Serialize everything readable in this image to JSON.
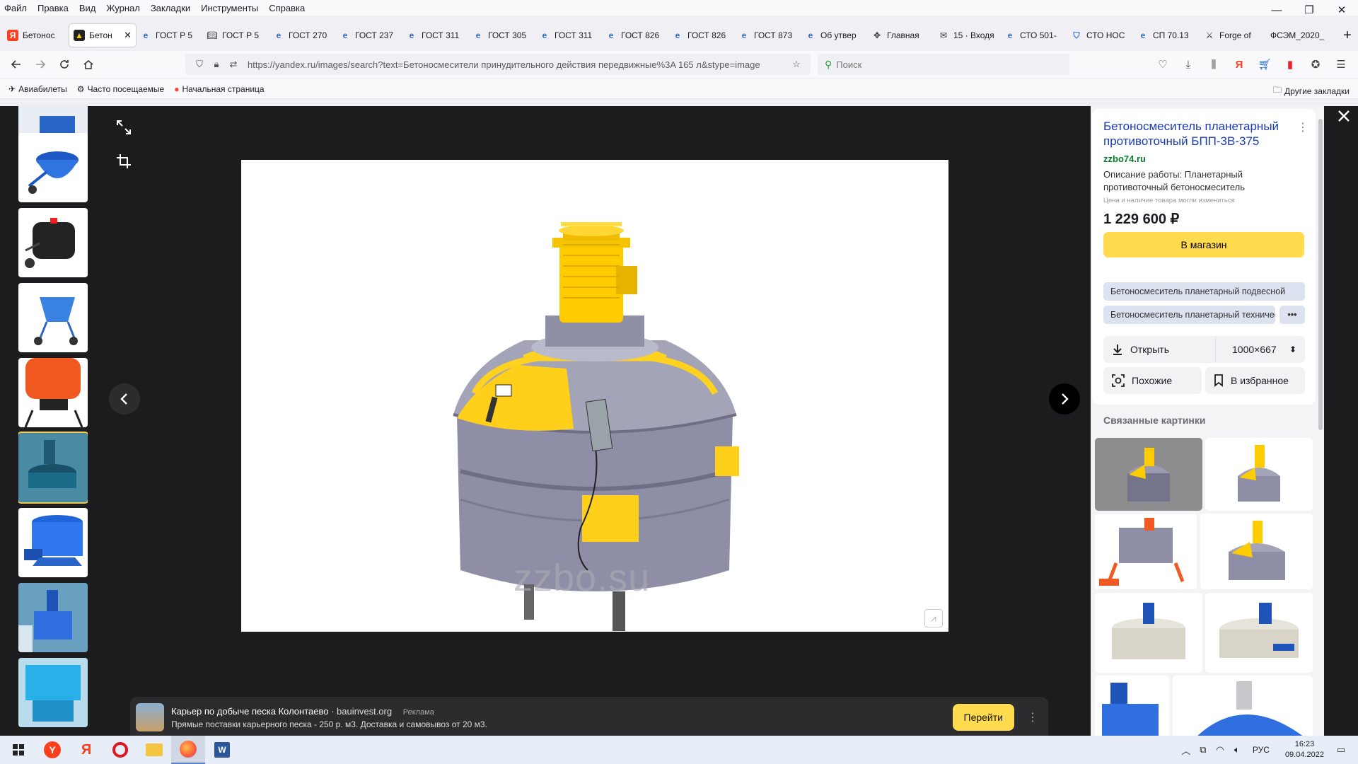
{
  "menu": [
    "Файл",
    "Правка",
    "Вид",
    "Журнал",
    "Закладки",
    "Инструменты",
    "Справка"
  ],
  "window_controls": {
    "minimize": "—",
    "restore": "❐",
    "close": "✕"
  },
  "tabs": [
    {
      "label": "Бетонос",
      "favicon": "yandex-icon"
    },
    {
      "label": "Бетон",
      "favicon": "beton-icon",
      "active": true
    },
    {
      "label": "ГОСТ Р 5",
      "favicon": "e-icon"
    },
    {
      "label": "ГОСТ Р 5",
      "favicon": "book-icon"
    },
    {
      "label": "ГОСТ 270",
      "favicon": "e-icon"
    },
    {
      "label": "ГОСТ 237",
      "favicon": "e-icon"
    },
    {
      "label": "ГОСТ 311",
      "favicon": "e-icon"
    },
    {
      "label": "ГОСТ 305",
      "favicon": "e-icon"
    },
    {
      "label": "ГОСТ 311",
      "favicon": "e-icon"
    },
    {
      "label": "ГОСТ 826",
      "favicon": "e-icon"
    },
    {
      "label": "ГОСТ 826",
      "favicon": "e-icon"
    },
    {
      "label": "ГОСТ 873",
      "favicon": "e-icon"
    },
    {
      "label": "Об утвер",
      "favicon": "e-icon"
    },
    {
      "label": "Главная",
      "favicon": "emblem-icon"
    },
    {
      "label": "15 · Входя",
      "favicon": "mail-icon"
    },
    {
      "label": "СТО 501-",
      "favicon": "e-icon"
    },
    {
      "label": "СТО НОС",
      "favicon": "shield-icon"
    },
    {
      "label": "СП 70.13",
      "favicon": "e-icon"
    },
    {
      "label": "Forge of",
      "favicon": "game-icon"
    },
    {
      "label": "ФСЭМ_2020_",
      "favicon": "none"
    }
  ],
  "address_bar": {
    "url": "https://yandex.ru/images/search?text=Бетоносмесители принудительного действия передвижные%3A 165 л&stype=image"
  },
  "search_bar": {
    "placeholder": "Поиск"
  },
  "bookmarks": [
    {
      "label": "Авиабилеты",
      "icon": "plane-icon"
    },
    {
      "label": "Часто посещаемые",
      "icon": "gear-icon"
    },
    {
      "label": "Начальная страница",
      "icon": "yandex-icon"
    }
  ],
  "other_bookmarks": "Другие закладки",
  "image": {
    "watermark": "zzbo.su"
  },
  "product": {
    "title": "Бетоносмеситель планетарный противоточный БПП-3В-375",
    "domain": "zzbo74.ru",
    "description": "Описание работы: Планетарный противоточный бетоносмеситель",
    "price_note": "Цена и наличие товара могли измениться",
    "price": "1 229 600 ₽",
    "shop_button": "В магазин",
    "tags": [
      "Бетоносмеситель планетарный подвесной",
      "Бетоносмеситель планетарный технический"
    ],
    "tags_more": "•••",
    "open_label": "Открыть",
    "size": "1000×667",
    "similar_label": "Похожие",
    "favorite_label": "В избранное"
  },
  "related_title": "Связанные картинки",
  "ad": {
    "title": "Карьер по добыче песка Колонтаево",
    "source": "· bauinvest.org",
    "tag": "Реклама",
    "description": "Прямые поставки карьерного песка - 250 р. м3. Доставка и самовывоз от 20 м3.",
    "button": "Перейти"
  },
  "taskbar": {
    "lang": "РУС",
    "time": "16:23",
    "date": "09.04.2022"
  },
  "colors": {
    "accent_yellow": "#ffdb4d",
    "link_blue": "#1a3bb3",
    "domain_green": "#0b7d2c",
    "viewer_bg": "#1c1c1e"
  }
}
